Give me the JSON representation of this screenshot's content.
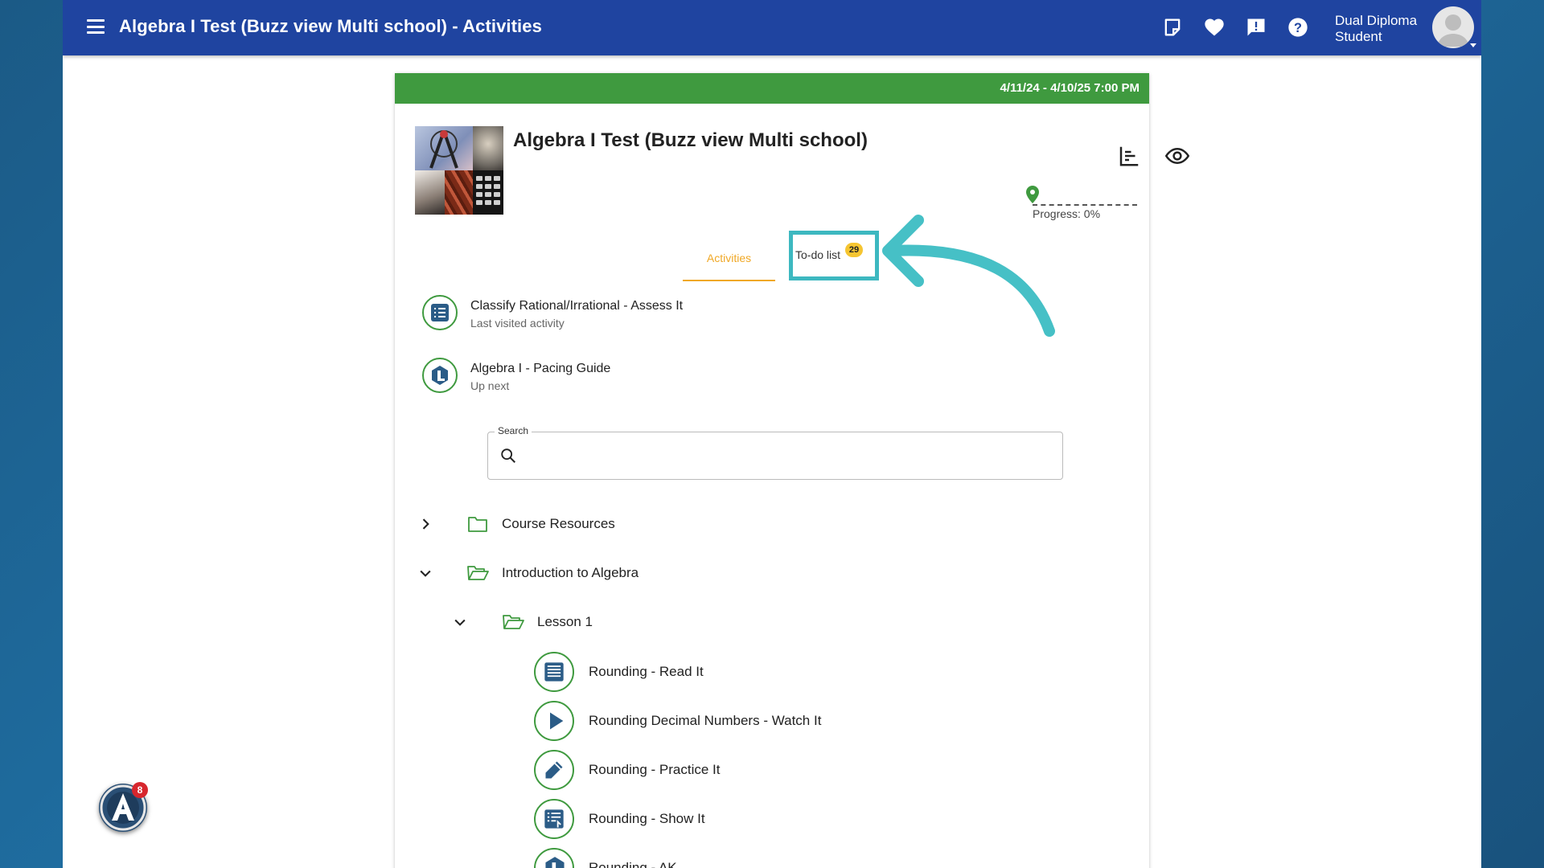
{
  "topbar": {
    "title": "Algebra I Test (Buzz view Multi school) - Activities",
    "user_name": "Dual Diploma Student",
    "icons": [
      "notes-icon",
      "heart-icon",
      "feedback-icon",
      "help-icon"
    ]
  },
  "course": {
    "date_range": "4/11/24 - 4/10/25 7:00 PM",
    "title": "Algebra I Test (Buzz view Multi school)",
    "progress_label": "Progress: 0%",
    "progress": 0
  },
  "tabs": {
    "activities": "Activities",
    "todo": "To-do list",
    "todo_count": "29"
  },
  "quick_links": [
    {
      "title": "Classify Rational/Irrational - Assess It",
      "subtitle": "Last visited activity"
    },
    {
      "title": "Algebra I - Pacing Guide",
      "subtitle": "Up next"
    }
  ],
  "search": {
    "label": "Search",
    "value": ""
  },
  "tree": {
    "folders": [
      {
        "label": "Course Resources",
        "expanded": false
      },
      {
        "label": "Introduction to Algebra",
        "expanded": true
      },
      {
        "label": "Lesson 1",
        "expanded": true
      }
    ],
    "activities": [
      {
        "label": "Rounding - Read It",
        "icon": "document-icon"
      },
      {
        "label": "Rounding Decimal Numbers - Watch It",
        "icon": "play-icon"
      },
      {
        "label": "Rounding - Practice It",
        "icon": "pencil-icon"
      },
      {
        "label": "Rounding - Show It",
        "icon": "checklist-icon"
      },
      {
        "label": "Rounding - AK",
        "icon": "guide-icon"
      }
    ]
  },
  "floating_widget": {
    "badge": "8"
  },
  "colors": {
    "topbar": "#1f44a0",
    "date_bar": "#3f9a3f",
    "accent": "#f0a826",
    "highlight": "#3db8c0"
  }
}
